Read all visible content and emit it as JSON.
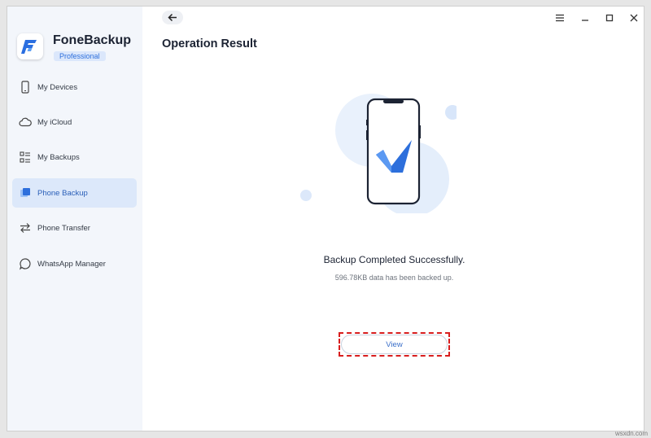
{
  "app": {
    "name": "FoneBackup",
    "edition": "Professional"
  },
  "sidebar": {
    "items": [
      {
        "label": "My Devices",
        "icon": "phone-outline-icon",
        "active": false
      },
      {
        "label": "My iCloud",
        "icon": "cloud-icon",
        "active": false
      },
      {
        "label": "My Backups",
        "icon": "list-icon",
        "active": false
      },
      {
        "label": "Phone Backup",
        "icon": "stacked-layers-icon",
        "active": true
      },
      {
        "label": "Phone Transfer",
        "icon": "transfer-arrows-icon",
        "active": false
      },
      {
        "label": "WhatsApp Manager",
        "icon": "chat-bubble-icon",
        "active": false
      }
    ]
  },
  "main": {
    "title": "Operation Result",
    "result_title": "Backup Completed Successfully.",
    "result_subtitle": "596.78KB data has been backed up.",
    "view_label": "View"
  },
  "watermark": "wsxdn.com",
  "colors": {
    "accent": "#2d6fdc",
    "sidebar_bg": "#f3f6fb",
    "active_item_bg": "#dce8fa",
    "highlight": "#d81e1e"
  }
}
